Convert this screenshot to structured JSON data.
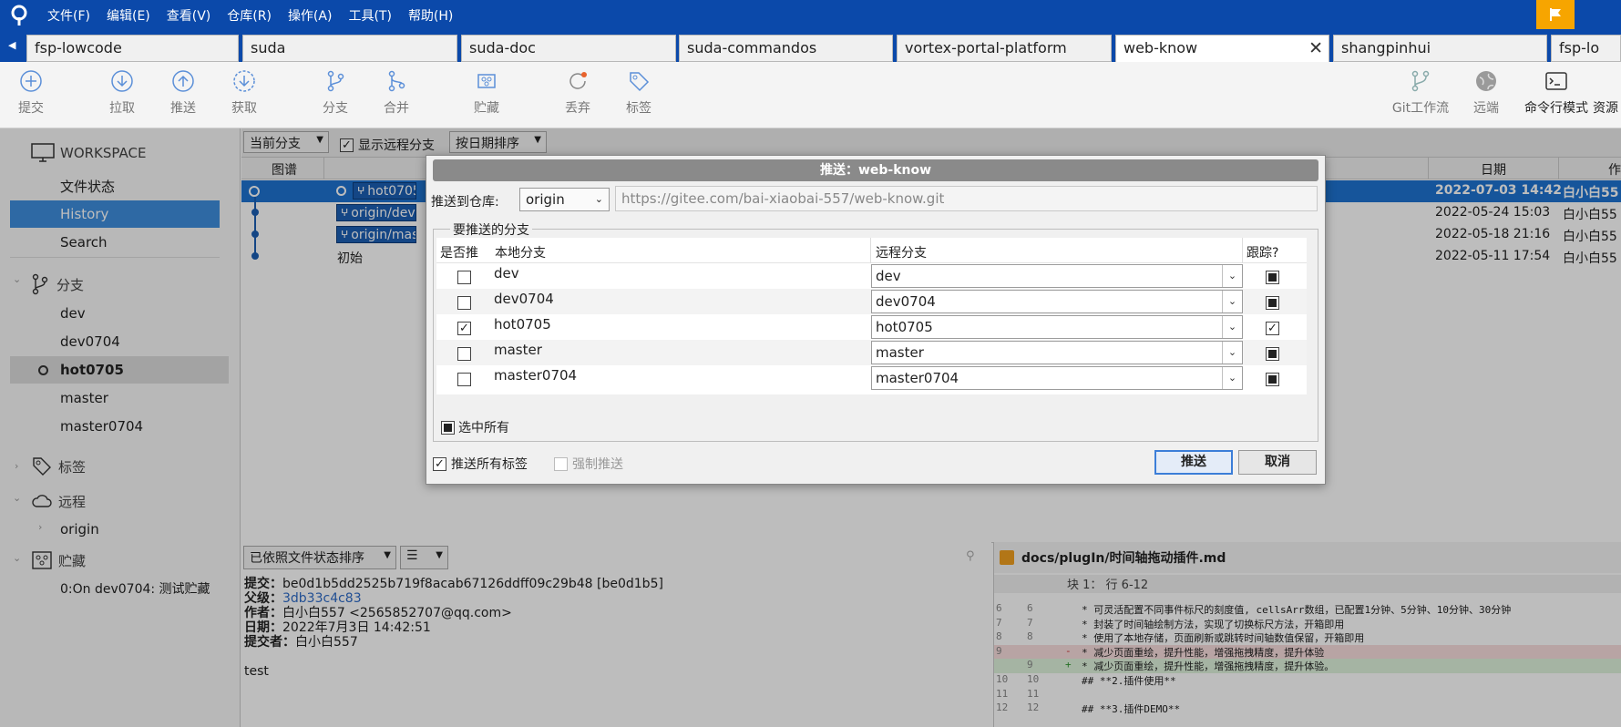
{
  "menubar": {
    "items": [
      "文件(F)",
      "编辑(E)",
      "查看(V)",
      "仓库(R)",
      "操作(A)",
      "工具(T)",
      "帮助(H)"
    ]
  },
  "tabs": [
    "fsp-lowcode",
    "suda",
    "suda-doc",
    "suda-commandos",
    "vortex-portal-platform",
    "web-know",
    "shangpinhui",
    "fsp-lo"
  ],
  "toolbar": {
    "commit": "提交",
    "pull": "拉取",
    "push": "推送",
    "fetch": "获取",
    "branch": "分支",
    "merge": "合并",
    "stash": "贮藏",
    "discard": "丢弃",
    "tag": "标签",
    "gitflow": "Git工作流",
    "remote": "远端",
    "terminal": "命令行模式",
    "explorer": "资源"
  },
  "sidebar": {
    "workspace": "WORKSPACE",
    "file_status": "文件状态",
    "history": "History",
    "search": "Search",
    "branches_head": "分支",
    "branches": [
      "dev",
      "dev0704",
      "hot0705",
      "master",
      "master0704"
    ],
    "tags_head": "标签",
    "remotes_head": "远程",
    "remote_origin": "origin",
    "stash_head": "贮藏",
    "stash_item": "0:On dev0704: 测试贮藏"
  },
  "filterbar": {
    "branch_filter": "当前分支",
    "show_remote": "显示远程分支",
    "sort": "按日期排序"
  },
  "columns": {
    "graph": "图谱",
    "date": "日期",
    "author": "作"
  },
  "commits": [
    {
      "tag": "hot0705",
      "date": "2022-07-03 14:42",
      "author": "白小白55"
    },
    {
      "tag": "origin/dev",
      "date": "2022-05-24 15:03",
      "author": "白小白55"
    },
    {
      "tag": "origin/mas",
      "date": "2022-05-18 21:16",
      "author": "白小白55"
    },
    {
      "message": "初始",
      "date": "2022-05-11 17:54",
      "author": "白小白55"
    }
  ],
  "dialog": {
    "title": "推送：web-know",
    "push_to_label": "推送到仓库:",
    "remote": "origin",
    "url": "https://gitee.com/bai-xiaobai-557/web-know.git",
    "group_label": "要推送的分支",
    "headers": {
      "push": "是否推",
      "local": "本地分支",
      "remote": "远程分支",
      "track": "跟踪?"
    },
    "rows": [
      {
        "local": "dev",
        "remote": "dev",
        "push": false,
        "track": "filled"
      },
      {
        "local": "dev0704",
        "remote": "dev0704",
        "push": false,
        "track": "filled"
      },
      {
        "local": "hot0705",
        "remote": "hot0705",
        "push": true,
        "track": "checked"
      },
      {
        "local": "master",
        "remote": "master",
        "push": false,
        "track": "filled"
      },
      {
        "local": "master0704",
        "remote": "master0704",
        "push": false,
        "track": "filled"
      }
    ],
    "select_all": "选中所有",
    "push_all_tags": "推送所有标签",
    "force_push": "强制推送",
    "ok": "推送",
    "cancel": "取消"
  },
  "bottom": {
    "sort_by": "已依照文件状态排序",
    "commit_label": "提交：",
    "commit_value": "be0d1b5dd2525b719f8acab67126ddff09c29b48 [be0d1b5]",
    "parent_label": "父级：",
    "parent_value": "3db33c4c83",
    "author_label": "作者：",
    "author_value": "白小白557 <2565852707@qq.com>",
    "date_label": "日期：",
    "date_value": "2022年7月3日 14:42:51",
    "committer_label": "提交者：",
    "committer_value": "白小白557",
    "message": "test",
    "file_path": "docs/plugIn/时间轴拖动插件.md",
    "hunk": "块 1： 行 6-12",
    "diff": [
      {
        "old": "6",
        "new": "6",
        "mark": "",
        "text": "*  可灵活配置不同事件标尺的刻度值, cellsArr数组，已配置1分钟、5分钟、10分钟、30分钟",
        "kind": "ctx"
      },
      {
        "old": "7",
        "new": "7",
        "mark": "",
        "text": "*  封装了时间轴绘制方法，实现了切换标尺方法，开箱即用",
        "kind": "ctx"
      },
      {
        "old": "8",
        "new": "8",
        "mark": "",
        "text": "*  使用了本地存储，页面刷新或跳转时间轴数值保留，开箱即用",
        "kind": "ctx"
      },
      {
        "old": "9",
        "new": "",
        "mark": "-",
        "text": "*  减少页面重绘，提升性能，增强拖拽精度，提升体验",
        "kind": "del"
      },
      {
        "old": "",
        "new": "9",
        "mark": "+",
        "text": "*  减少页面重绘，提升性能，增强拖拽精度，提升体验。",
        "kind": "add"
      },
      {
        "old": "10",
        "new": "10",
        "mark": "",
        "text": "## **2.插件使用**",
        "kind": "ctx"
      },
      {
        "old": "11",
        "new": "11",
        "mark": "",
        "text": "",
        "kind": "ctx"
      },
      {
        "old": "12",
        "new": "12",
        "mark": "",
        "text": "## **3.插件DEMO**",
        "kind": "ctx"
      }
    ]
  },
  "colors": {
    "menubar": "#0b49aa",
    "accent": "#1e73d2",
    "flag": "#f7a500"
  }
}
